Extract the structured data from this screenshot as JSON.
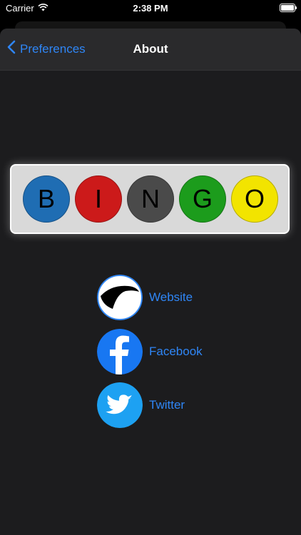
{
  "status_bar": {
    "carrier": "Carrier",
    "time": "2:38 PM"
  },
  "nav": {
    "back_label": "Preferences",
    "title": "About"
  },
  "bingo": {
    "letters": [
      "B",
      "I",
      "N",
      "G",
      "O"
    ],
    "colors": [
      "#1f6db3",
      "#cc1a1a",
      "#4a4a4a",
      "#1c9c1c",
      "#f2e400"
    ]
  },
  "links": [
    {
      "label": "Website",
      "icon": "website-logo-icon"
    },
    {
      "label": "Facebook",
      "icon": "facebook-icon"
    },
    {
      "label": "Twitter",
      "icon": "twitter-icon"
    }
  ],
  "colors": {
    "accent": "#2f86f6",
    "background": "#1c1c1e"
  }
}
